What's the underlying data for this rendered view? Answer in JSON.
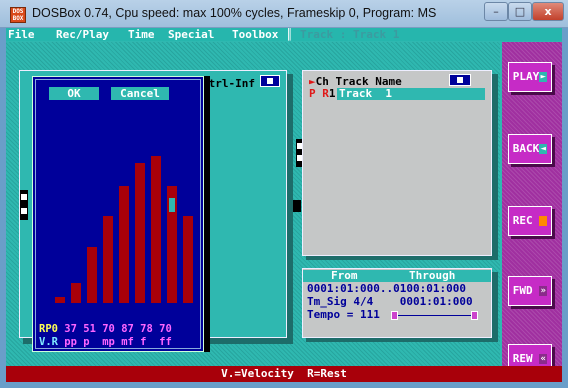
{
  "window": {
    "title": "DOSBox 0.74, Cpu speed: max 100% cycles, Frameskip  0, Program:     MS",
    "icon_text": "DOS BOX",
    "minimize": "–",
    "maximize": "□",
    "close": "x"
  },
  "menu": {
    "items": [
      "File",
      "Rec/Play",
      "Time",
      "Special",
      "Toolbox"
    ],
    "track_title": "Track : Track  1"
  },
  "velocity_dialog": {
    "ok_label": "OK",
    "cancel_label": "Cancel",
    "row1_label": "RP0",
    "row1_values": "37 51 70 87 78 70",
    "row2_label": "V.R",
    "row2_values": "pp p  mp mf f  ff",
    "bar_levels": [
      0.04,
      0.13,
      0.37,
      0.58,
      0.78,
      0.93,
      0.98,
      0.78,
      0.58
    ],
    "selected_bar": 7,
    "colors": {
      "bar": "#a8000a",
      "background": "#00009a",
      "selected": "#2fb8b0"
    }
  },
  "ctrl_panel": {
    "label": "Ctrl-Inf"
  },
  "track_list": {
    "header": "Ch Track Name",
    "rows": [
      {
        "flags": "P R",
        "channel": "1",
        "name": "Track  1"
      }
    ]
  },
  "range": {
    "from_label": "From",
    "through_label": "Through",
    "from_to": "0001:01:000..0100:01:000",
    "tmsig": "Tm_Sig 4/4    0001:01:000",
    "tempo": "Tempo = 111"
  },
  "transport": {
    "play": "PLAY",
    "back": "BACK",
    "rec": "REC",
    "fwd": "FWD",
    "rew": "REW"
  },
  "status_bar": "V.=Velocity  R=Rest"
}
